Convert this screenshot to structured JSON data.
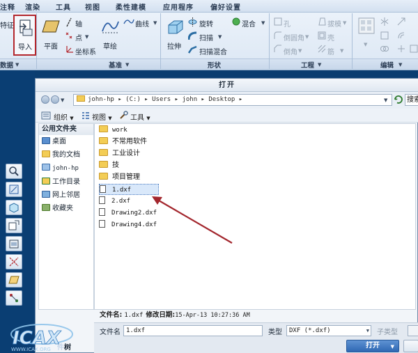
{
  "ribbon": {
    "tabs": [
      "注释",
      "渲染",
      "工具",
      "视图",
      "柔性建模",
      "应用程序",
      "偏好设置"
    ],
    "groups": {
      "get_data": "数据",
      "datum": "基准",
      "shapes": "形状",
      "engineering": "工程",
      "editing": "编辑"
    },
    "buttons": {
      "feature_partial": "特征",
      "import": "导入",
      "plane": "平面",
      "axis": "轴",
      "point": "点",
      "csys": "坐标系",
      "sketch": "草绘",
      "curve": "曲线",
      "extrude": "拉伸",
      "revolve": "旋转",
      "sweep": "扫描",
      "swept_blend": "扫描混合",
      "blend": "混合",
      "hole": "孔",
      "round": "倒圆角",
      "chamfer": "倒角",
      "draft": "拔模",
      "shell": "壳",
      "rib": "筋"
    }
  },
  "dialog": {
    "title": "打开",
    "address_path": "john-hp  ▸  (C:)  ▸  Users  ▸  john  ▸  Desktop  ▸",
    "search_partial": "搜索",
    "toolbar": {
      "organize": "组织",
      "views": "视图",
      "tools": "工具"
    },
    "nav": {
      "header": "公用文件夹",
      "items": [
        "桌面",
        "我的文档",
        "john-hp",
        "工作目录",
        "网上邻居",
        "收藏夹"
      ]
    },
    "files": [
      {
        "name": "work",
        "type": "folder"
      },
      {
        "name": "不常用软件",
        "type": "folder"
      },
      {
        "name": "工业设计",
        "type": "folder"
      },
      {
        "name": "技",
        "type": "folder"
      },
      {
        "name": "项目管理",
        "type": "folder"
      },
      {
        "name": "1.dxf",
        "type": "file",
        "selected": true
      },
      {
        "name": "2.dxf",
        "type": "file"
      },
      {
        "name": "Drawing2.dxf",
        "type": "file"
      },
      {
        "name": "Drawing4.dxf",
        "type": "file"
      }
    ],
    "info": {
      "filename_label": "文件名:",
      "filename_value": "1.dxf",
      "modified_label": "修改日期:",
      "modified_value": "15-Apr-13 10:27:36 AM"
    },
    "bottom": {
      "filename_label": "文件名",
      "filename_value": "1.dxf",
      "type_label": "类型",
      "type_value": "DXF (*.dxf)",
      "subtype_label": "子类型",
      "open_label": "打开",
      "tree_partial": "树"
    }
  },
  "logo": {
    "text": "ICAX",
    "sub": "WWW.ICAX.ORG"
  },
  "colors": {
    "accent": "#2f68b3",
    "highlight": "#c0272d",
    "arrow": "#a3262d"
  }
}
